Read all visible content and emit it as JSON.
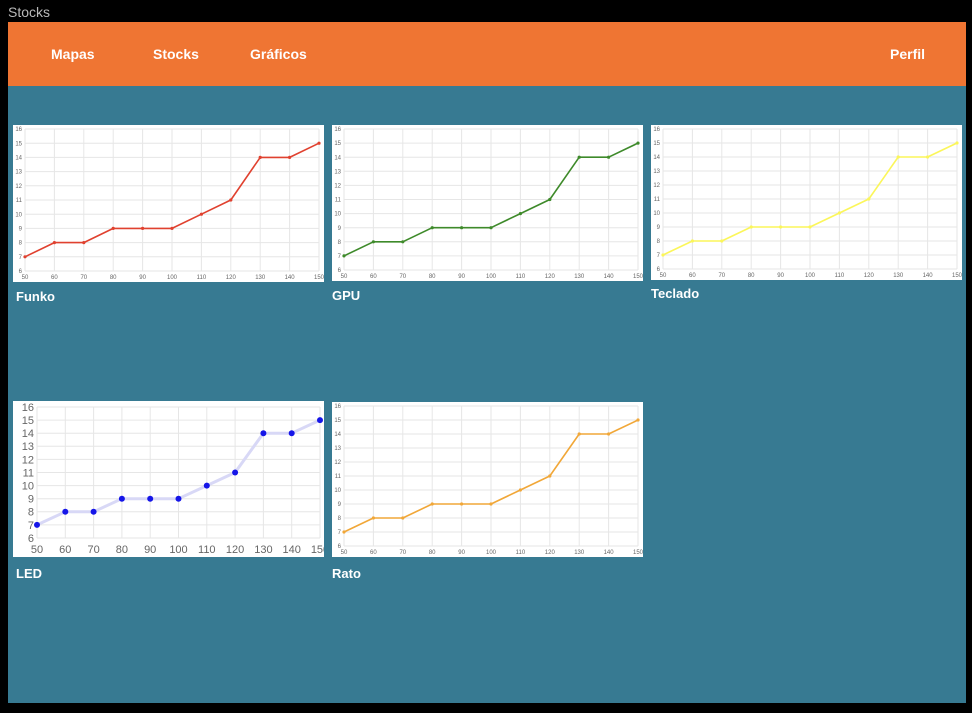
{
  "window": {
    "title": "Stocks"
  },
  "nav": {
    "mapas": "Mapas",
    "stocks": "Stocks",
    "graficos": "Gráficos",
    "perfil": "Perfil"
  },
  "charts": [
    {
      "id": "funko",
      "label": "Funko",
      "color": "#e0412f"
    },
    {
      "id": "gpu",
      "label": "GPU",
      "color": "#3e8a2a"
    },
    {
      "id": "teclado",
      "label": "Teclado",
      "color": "#fbf65a"
    },
    {
      "id": "led",
      "label": "LED",
      "color": "#1515e8",
      "line_color": "#d8d8f6"
    },
    {
      "id": "rato",
      "label": "Rato",
      "color": "#f1a738"
    }
  ],
  "chart_data": [
    {
      "type": "line",
      "name": "Funko",
      "x": [
        50,
        60,
        70,
        80,
        90,
        100,
        110,
        120,
        130,
        140,
        150
      ],
      "y": [
        7,
        8,
        8,
        9,
        9,
        9,
        10,
        11,
        14,
        14,
        15
      ],
      "xlim": [
        50,
        150
      ],
      "ylim": [
        6,
        16
      ],
      "yticks": [
        6,
        7,
        8,
        9,
        10,
        11,
        12,
        13,
        14,
        15,
        16
      ],
      "grid": true
    },
    {
      "type": "line",
      "name": "GPU",
      "x": [
        50,
        60,
        70,
        80,
        90,
        100,
        110,
        120,
        130,
        140,
        150
      ],
      "y": [
        7,
        8,
        8,
        9,
        9,
        9,
        10,
        11,
        14,
        14,
        15
      ],
      "xlim": [
        50,
        150
      ],
      "ylim": [
        6,
        16
      ],
      "yticks": [
        6,
        7,
        8,
        9,
        10,
        11,
        12,
        13,
        14,
        15,
        16
      ],
      "grid": true
    },
    {
      "type": "line",
      "name": "Teclado",
      "x": [
        50,
        60,
        70,
        80,
        90,
        100,
        110,
        120,
        130,
        140,
        150
      ],
      "y": [
        7,
        8,
        8,
        9,
        9,
        9,
        10,
        11,
        14,
        14,
        15
      ],
      "xlim": [
        50,
        150
      ],
      "ylim": [
        6,
        16
      ],
      "yticks": [
        6,
        7,
        8,
        9,
        10,
        11,
        12,
        13,
        14,
        15,
        16
      ],
      "grid": true
    },
    {
      "type": "line",
      "name": "LED",
      "x": [
        50,
        60,
        70,
        80,
        90,
        100,
        110,
        120,
        130,
        140,
        150
      ],
      "y": [
        7,
        8,
        8,
        9,
        9,
        9,
        10,
        11,
        14,
        14,
        15
      ],
      "xlim": [
        50,
        150
      ],
      "ylim": [
        6,
        16
      ],
      "yticks": [
        6,
        7,
        8,
        9,
        10,
        11,
        12,
        13,
        14,
        15,
        16
      ],
      "grid": true
    },
    {
      "type": "line",
      "name": "Rato",
      "x": [
        50,
        60,
        70,
        80,
        90,
        100,
        110,
        120,
        130,
        140,
        150
      ],
      "y": [
        7,
        8,
        8,
        9,
        9,
        9,
        10,
        11,
        14,
        14,
        15
      ],
      "xlim": [
        50,
        150
      ],
      "ylim": [
        6,
        16
      ],
      "yticks": [
        6,
        7,
        8,
        9,
        10,
        11,
        12,
        13,
        14,
        15,
        16
      ],
      "grid": true
    }
  ]
}
